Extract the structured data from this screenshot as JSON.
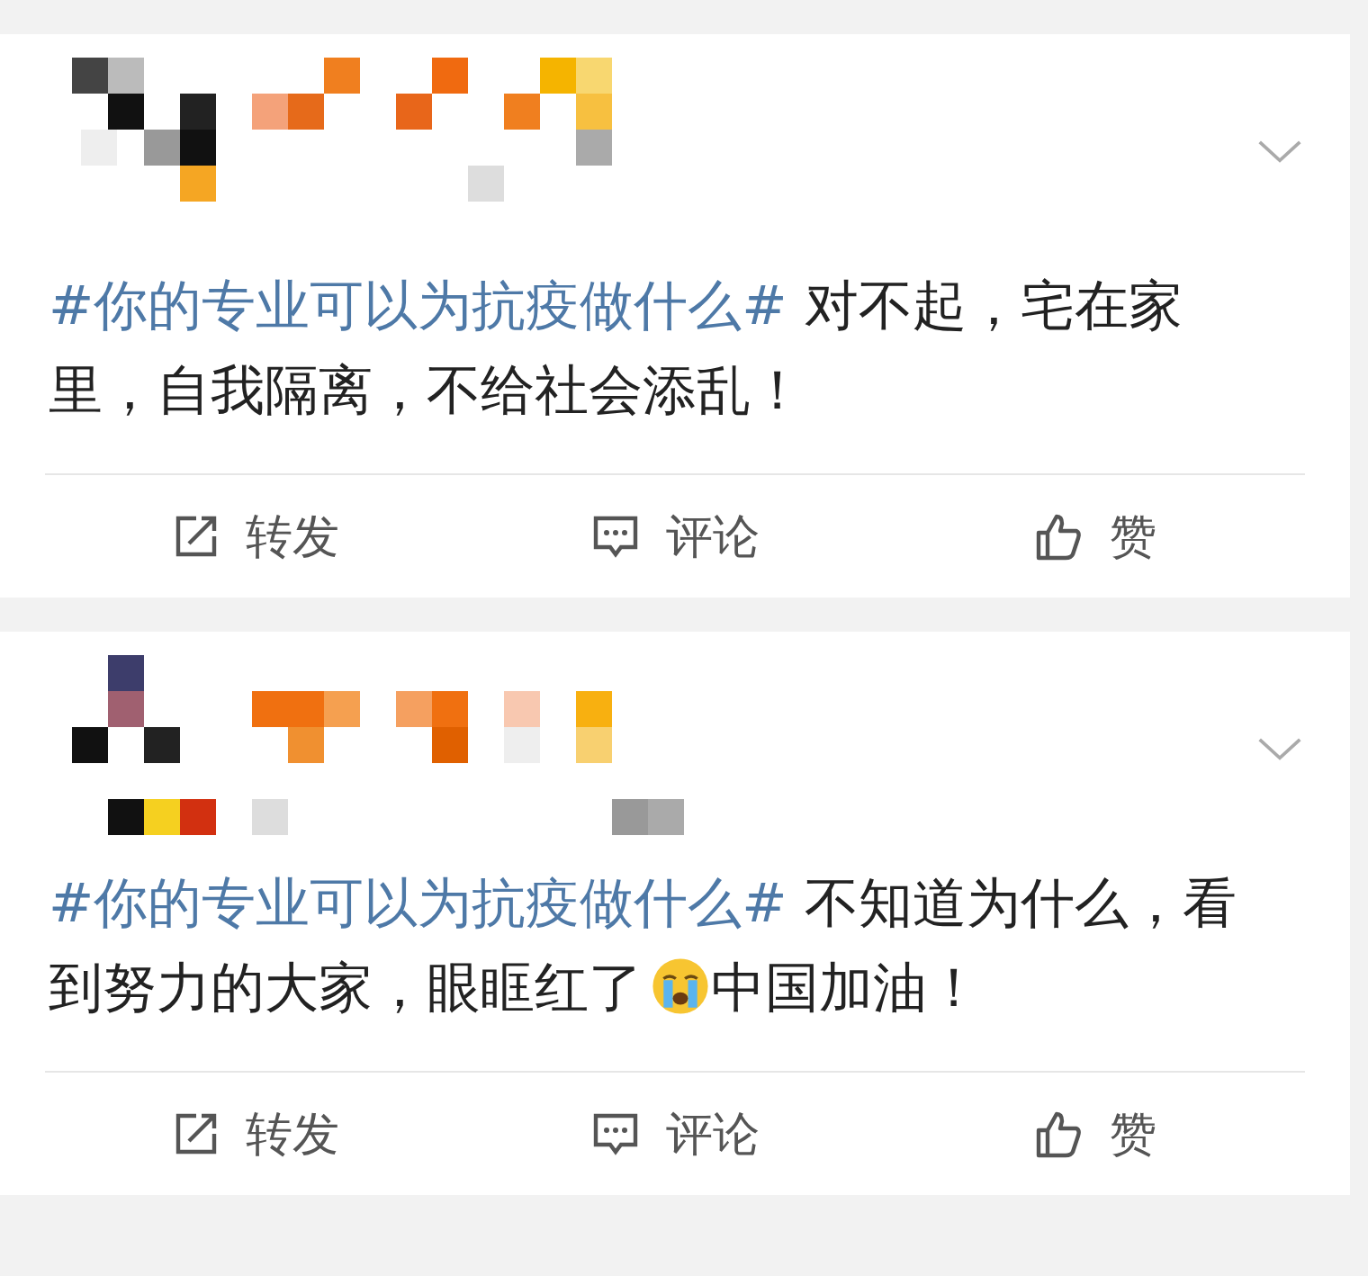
{
  "posts": [
    {
      "kind": "picture",
      "hashtag": "#你的专业可以为抗疫做什么#",
      "body": [
        {
          "kind": "text",
          "text": "对不起，宅在家里，自我隔离，不给社会添乱！"
        }
      ],
      "actions": [
        {
          "kind": "repost",
          "label": "转发"
        },
        {
          "kind": "comment",
          "label": "评论"
        },
        {
          "kind": "like",
          "label": "赞"
        }
      ]
    },
    {
      "kind": "picture",
      "hashtag": "#你的专业可以为抗疫做什么#",
      "body": [
        {
          "kind": "text",
          "text": "不知道为什么，看到努力的大家，眼眶红了"
        },
        {
          "kind": "emoji"
        },
        {
          "kind": "text",
          "text": "中国加油！"
        }
      ],
      "actions": [
        {
          "kind": "repost",
          "label": "转发"
        },
        {
          "kind": "comment",
          "label": "评论"
        },
        {
          "kind": "like",
          "label": "赞"
        }
      ]
    }
  ]
}
